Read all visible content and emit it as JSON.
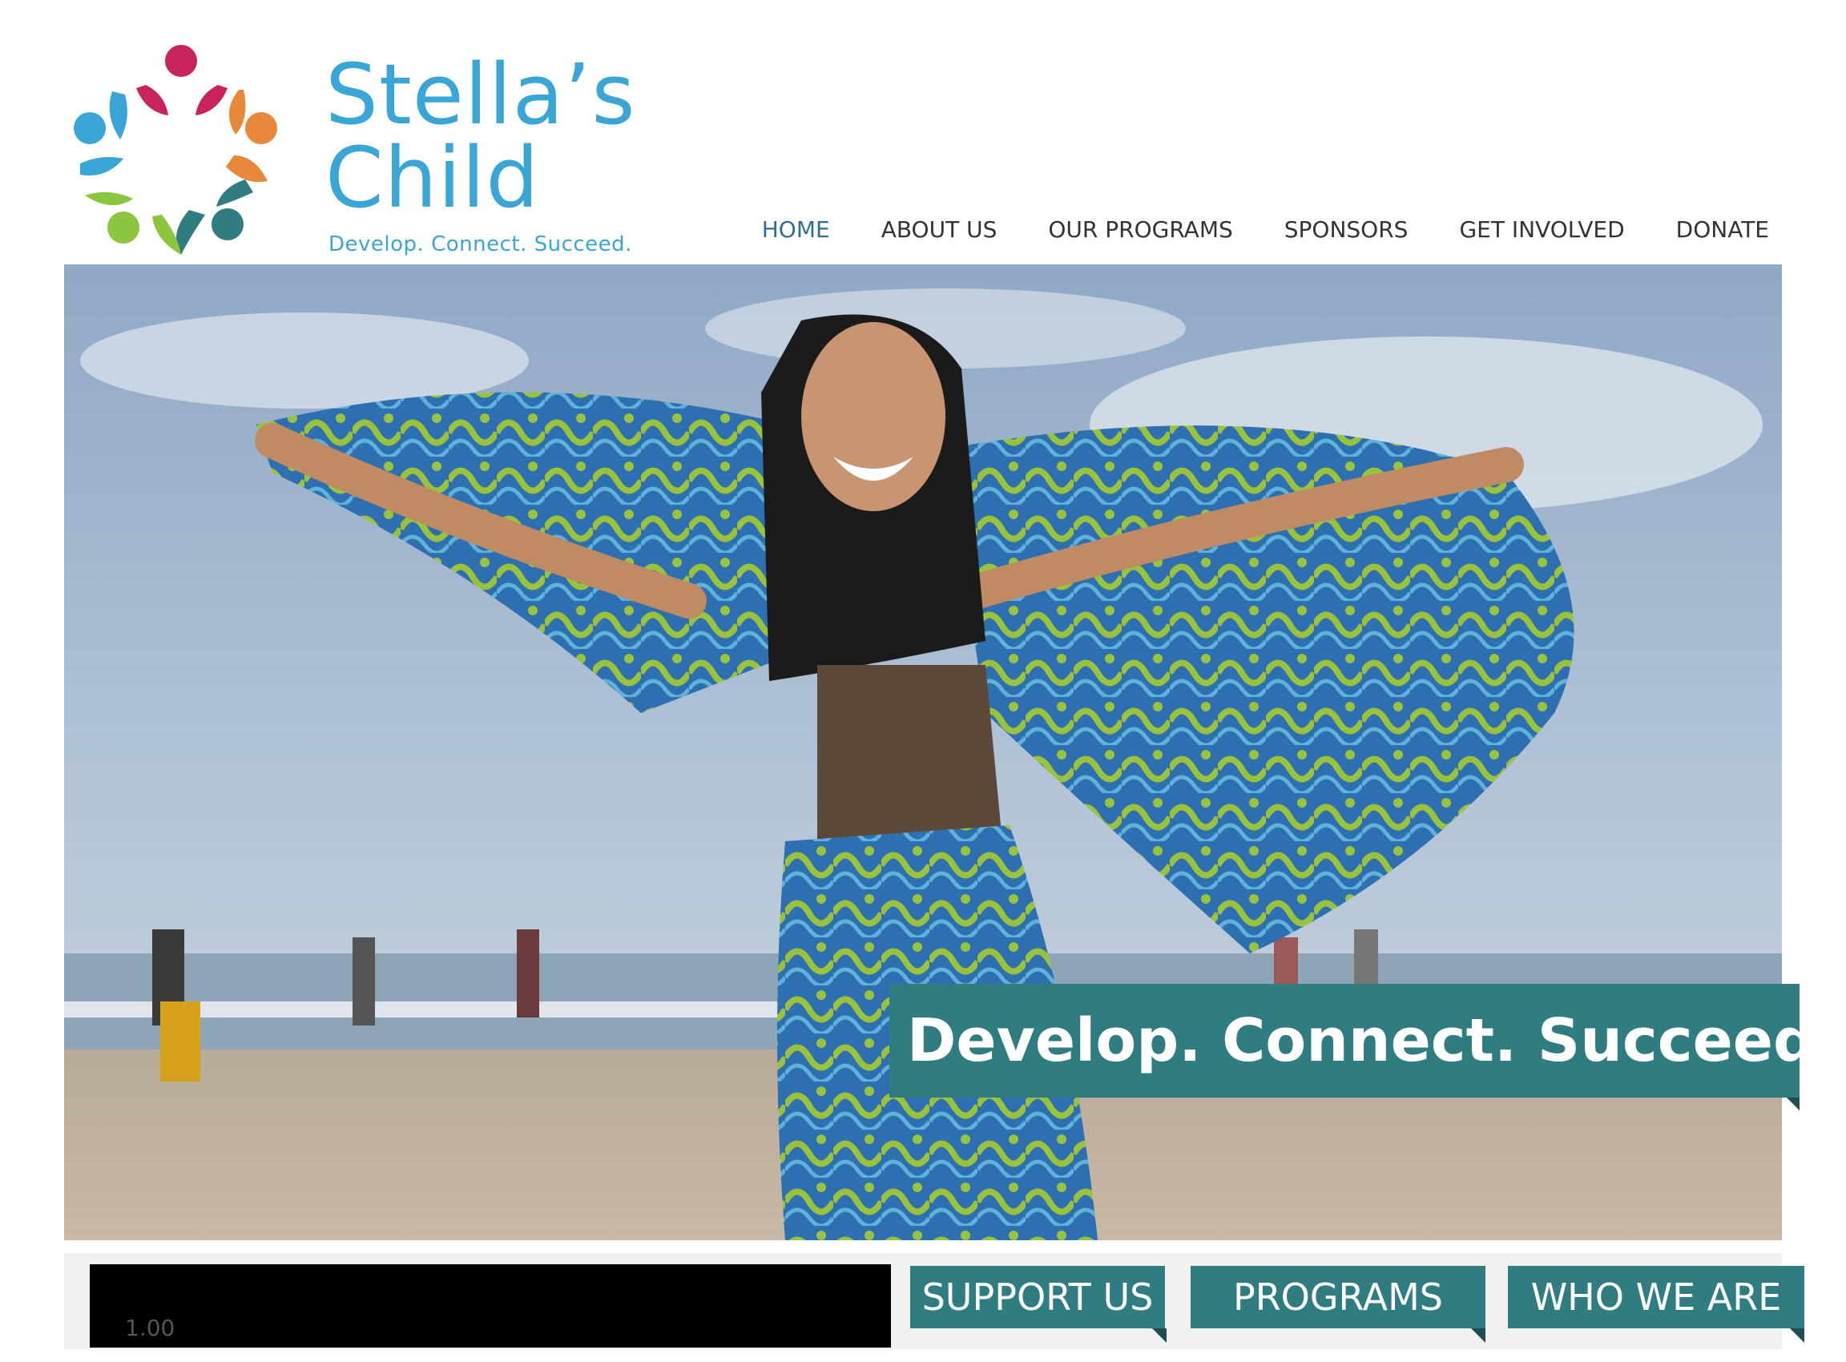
{
  "brand": {
    "name_line1": "Stella’s",
    "name_line2": "Child",
    "tagline": "Develop. Connect. Succeed.",
    "colors": {
      "primary_blue": "#3aa6d6",
      "teal": "#2f7d80",
      "magenta": "#c9235f",
      "orange": "#e8883a",
      "green": "#8cc63e"
    }
  },
  "nav": {
    "items": [
      {
        "label": "HOME",
        "active": true
      },
      {
        "label": "ABOUT US"
      },
      {
        "label": "OUR PROGRAMS"
      },
      {
        "label": "SPONSORS"
      },
      {
        "label": "GET INVOLVED"
      },
      {
        "label": "DONATE"
      }
    ]
  },
  "hero": {
    "banner_text": "Develop. Connect. Succeed."
  },
  "bottom": {
    "video_time": "1.00",
    "cta": [
      {
        "label": "SUPPORT US"
      },
      {
        "label": "PROGRAMS"
      },
      {
        "label": "WHO WE ARE"
      }
    ]
  }
}
